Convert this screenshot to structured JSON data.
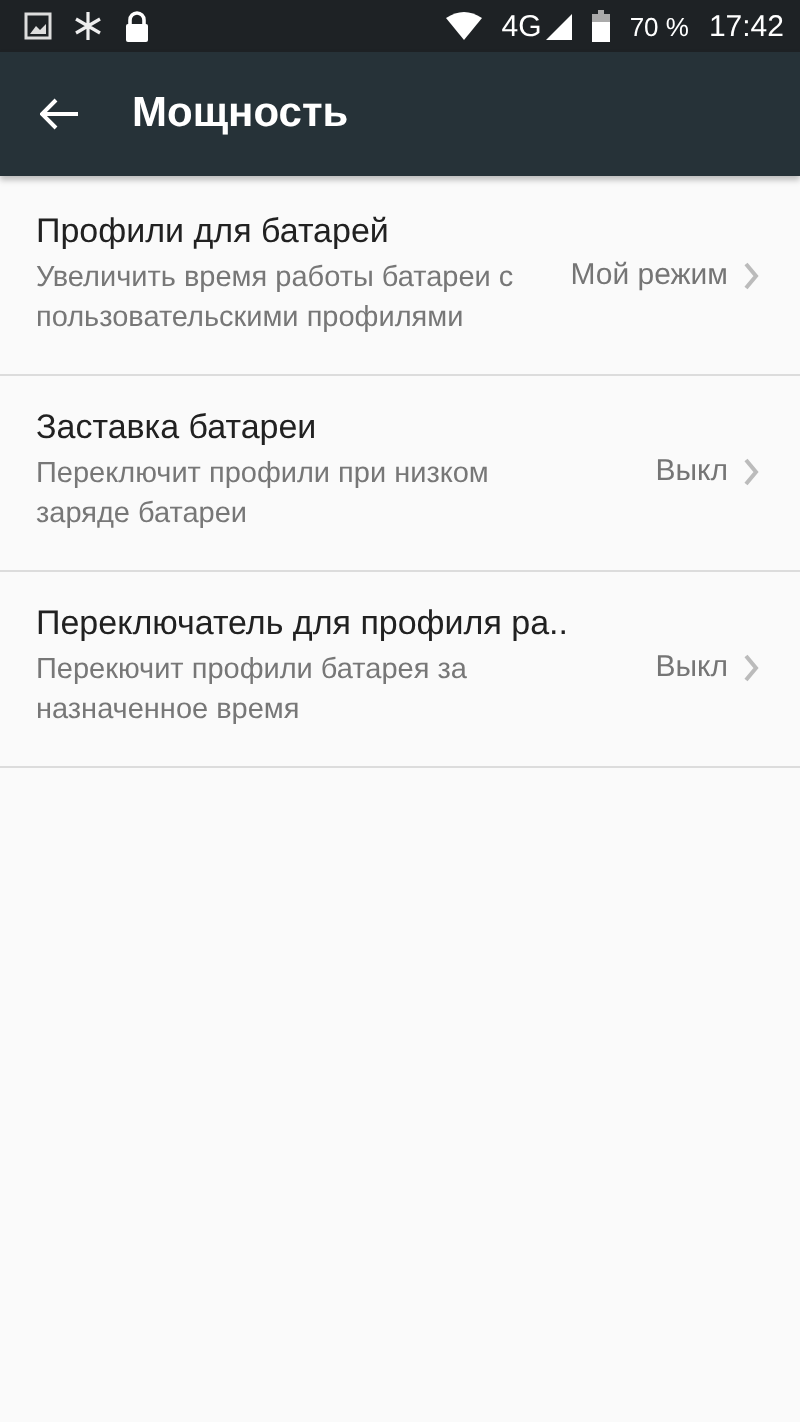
{
  "status_bar": {
    "network": "4G",
    "battery": "70 %",
    "time": "17:42"
  },
  "app_bar": {
    "title": "Мощность"
  },
  "items": [
    {
      "title": "Профили для батарей",
      "summary": "Увеличить время работы батареи с пользовательскими профилями",
      "value": "Мой режим"
    },
    {
      "title": "Заставка батареи",
      "summary": "Переключит профили при низком заряде батареи",
      "value": "Выкл"
    },
    {
      "title": "Переключатель для профиля ра..",
      "summary": "Перекючит профили батарея за назначенное время",
      "value": "Выкл"
    }
  ]
}
